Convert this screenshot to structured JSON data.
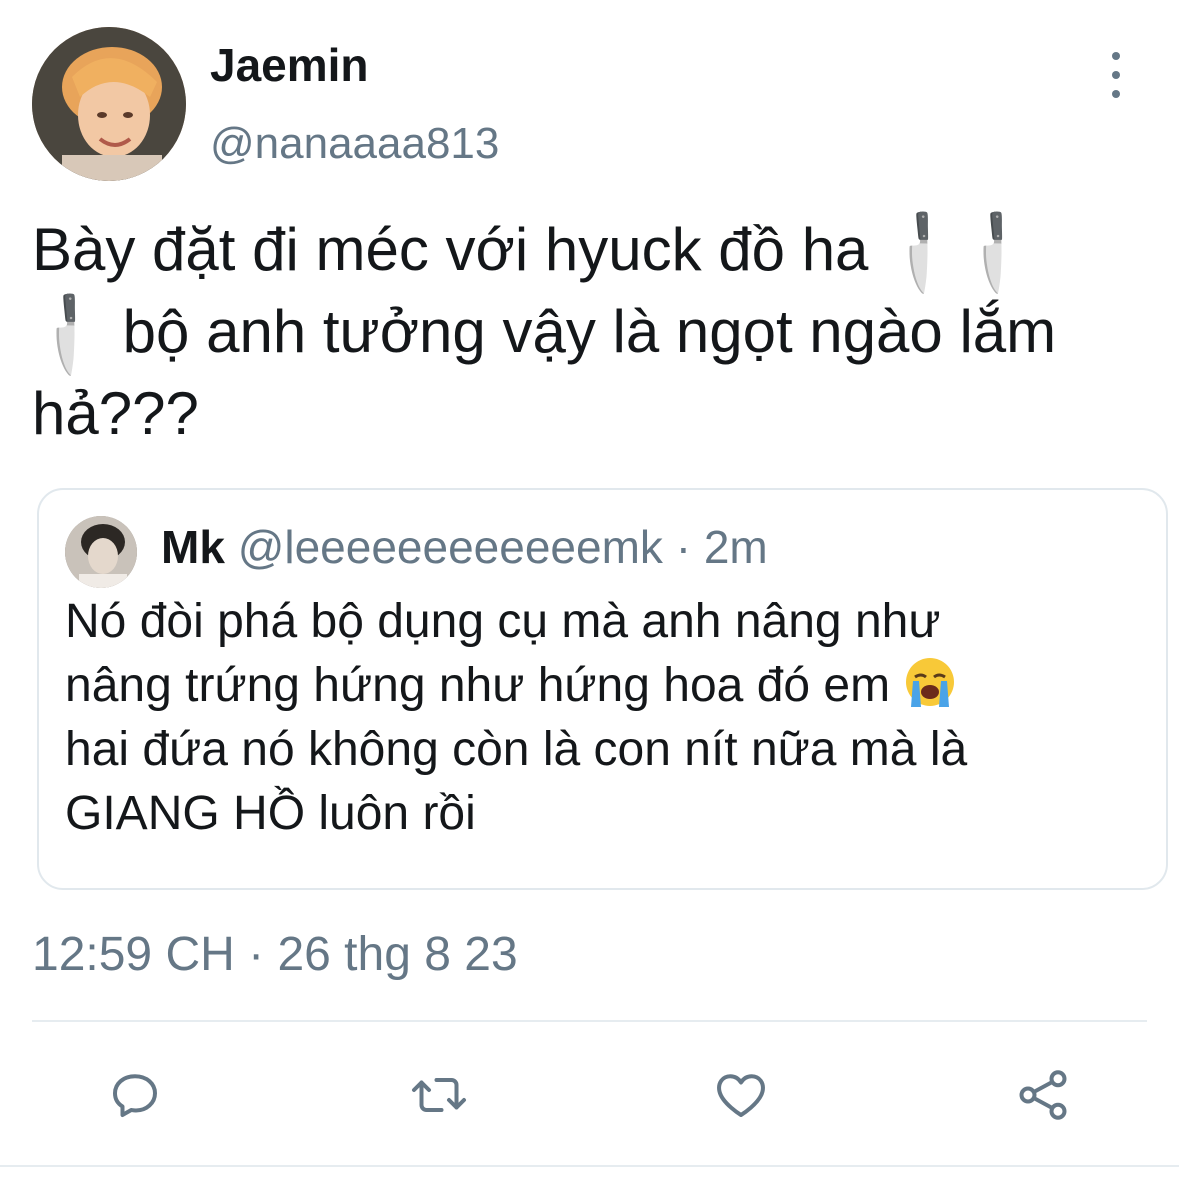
{
  "tweet": {
    "author": {
      "display_name": "Jaemin",
      "handle": "@nanaaaa813"
    },
    "text_parts": {
      "part1": "Bày đặt đi méc với hyuck đồ ha ",
      "part2": " bộ anh tưởng vậy là ngọt ngào lắm hả???"
    },
    "emoji": {
      "knife": "🔪"
    },
    "timestamp": "12:59 CH · 26 thg 8 23"
  },
  "quote": {
    "author_name": "Mk",
    "author_handle": "@leeeeeeeeeeeemk",
    "separator": " · ",
    "time": "2m",
    "text_line1": "Nó đòi phá bộ dụng cụ mà anh nâng như",
    "text_line2": "nâng trứng hứng như hứng hoa đó em ",
    "text_line3": "hai đứa nó không còn là con nít nữa mà là",
    "text_line4": "GIANG HỒ luôn rồi"
  },
  "icons": {
    "more": "more-vertical-icon",
    "reply": "reply-icon",
    "retweet": "retweet-icon",
    "like": "heart-icon",
    "share": "share-icon",
    "knife": "knife-emoji-icon",
    "cry": "loudly-crying-face-emoji"
  },
  "colors": {
    "text_primary": "#14171a",
    "text_secondary": "#657786",
    "border": "#e1e8ed"
  }
}
